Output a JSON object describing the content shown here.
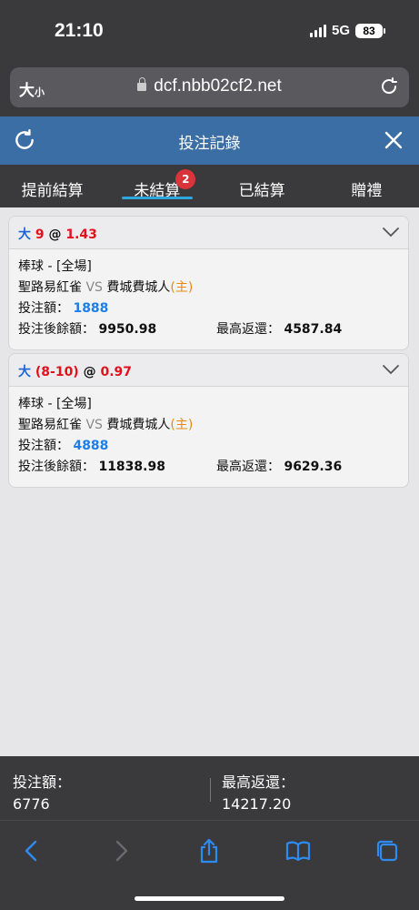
{
  "status": {
    "time": "21:10",
    "network": "5G",
    "battery": "83"
  },
  "browser": {
    "text_size_label": "大",
    "text_size_small": "小",
    "url": "dcf.nbb02cf2.net"
  },
  "header": {
    "title": "投注記錄"
  },
  "tabs": [
    {
      "label": "提前結算"
    },
    {
      "label": "未結算",
      "badge": "2"
    },
    {
      "label": "已結算"
    },
    {
      "label": "贈禮"
    }
  ],
  "bets": [
    {
      "selection": "大",
      "line": "9",
      "at": "@",
      "odds": "1.43",
      "sport_market": "棒球 - [全場]",
      "team_a": "聖路易紅雀",
      "vs": "VS",
      "team_b": "費城費城人",
      "home_tag": "(主)",
      "stake_label": "投注額：",
      "stake": "1888",
      "balance_label": "投注後餘額：",
      "balance": "9950.98",
      "max_return_label": "最高返還：",
      "max_return": "4587.84"
    },
    {
      "selection": "大",
      "line": "(8-10)",
      "at": "@",
      "odds": "0.97",
      "sport_market": "棒球 - [全場]",
      "team_a": "聖路易紅雀",
      "vs": "VS",
      "team_b": "費城費城人",
      "home_tag": "(主)",
      "stake_label": "投注額：",
      "stake": "4888",
      "balance_label": "投注後餘額：",
      "balance": "11838.98",
      "max_return_label": "最高返還：",
      "max_return": "9629.36"
    }
  ],
  "footer": {
    "total_stake_label": "投注額：",
    "total_stake": "6776",
    "total_return_label": "最高返還：",
    "total_return": "14217.20"
  },
  "icons": {
    "reload": "reload-icon",
    "refresh": "refresh-icon",
    "close": "close-icon",
    "chevron": "chevron-down-icon",
    "back": "back-icon",
    "forward": "forward-icon",
    "share": "share-icon",
    "bookmarks": "bookmarks-icon",
    "tabs": "tabs-icon"
  },
  "colors": {
    "header_blue": "#3a6ea5",
    "accent_blue": "#1e64d6",
    "odds_red": "#e3101e",
    "home_orange": "#e88a12",
    "badge_red": "#d9343a"
  }
}
